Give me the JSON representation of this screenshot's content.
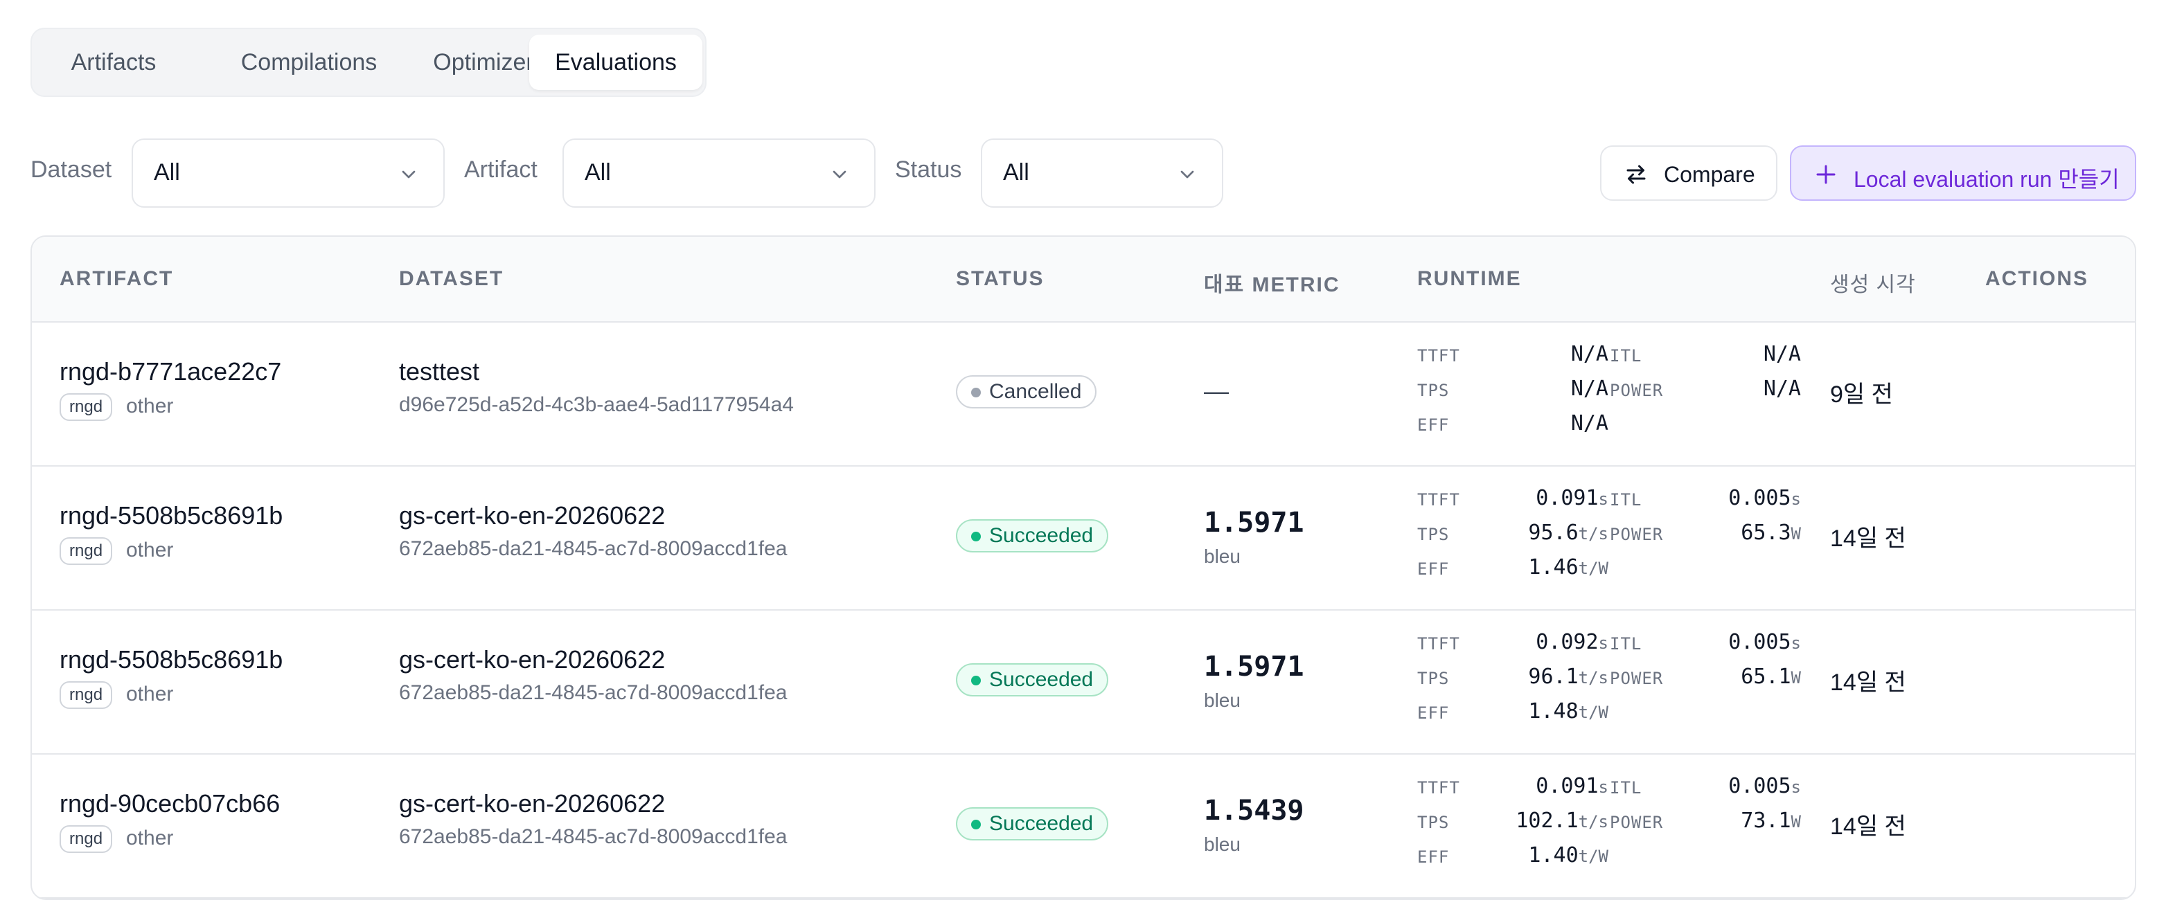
{
  "tabs": [
    {
      "label": "Artifacts",
      "active": false
    },
    {
      "label": "Compilations",
      "active": false
    },
    {
      "label": "Optimizer",
      "active": false
    },
    {
      "label": "Evaluations",
      "active": true
    }
  ],
  "filters": {
    "dataset": {
      "label": "Dataset",
      "value": "All"
    },
    "artifact": {
      "label": "Artifact",
      "value": "All"
    },
    "status": {
      "label": "Status",
      "value": "All"
    }
  },
  "actions": {
    "compare_label": "Compare",
    "compare_icon": "swap-arrows-icon",
    "local_run_label": "Local evaluation run 만들기",
    "local_run_icon": "plus-icon"
  },
  "table": {
    "headers": [
      "ARTIFACT",
      "DATASET",
      "STATUS",
      "대표 METRIC",
      "RUNTIME",
      "생성 시각",
      "ACTIONS"
    ],
    "rows": [
      {
        "artifact": "rngd-b7771ace22c7",
        "tag": "rngd",
        "category": "other",
        "dataset": "testtest",
        "dataset_id": "d96e725d-a52d-4c3b-aae4-5ad1177954a4",
        "status": "Cancelled",
        "metric_value": "—",
        "metric_unit": "",
        "runtime": {
          "ttft": "N/A",
          "ttft_u": "",
          "itl": "N/A",
          "itl_u": "",
          "tps": "N/A",
          "tps_u": "",
          "power": "N/A",
          "power_u": "",
          "eff": "N/A",
          "eff_u": ""
        },
        "created": "9일 전"
      },
      {
        "artifact": "rngd-5508b5c8691b",
        "tag": "rngd",
        "category": "other",
        "dataset": "gs-cert-ko-en-20260622",
        "dataset_id": "672aeb85-da21-4845-ac7d-8009accd1fea",
        "status": "Succeeded",
        "metric_value": "1.5971",
        "metric_unit": "bleu",
        "runtime": {
          "ttft": "0.091",
          "ttft_u": "s",
          "itl": "0.005",
          "itl_u": "s",
          "tps": "95.6",
          "tps_u": "t/s",
          "power": "65.3",
          "power_u": "W",
          "eff": "1.46",
          "eff_u": "t/W"
        },
        "created": "14일 전"
      },
      {
        "artifact": "rngd-5508b5c8691b",
        "tag": "rngd",
        "category": "other",
        "dataset": "gs-cert-ko-en-20260622",
        "dataset_id": "672aeb85-da21-4845-ac7d-8009accd1fea",
        "status": "Succeeded",
        "metric_value": "1.5971",
        "metric_unit": "bleu",
        "runtime": {
          "ttft": "0.092",
          "ttft_u": "s",
          "itl": "0.005",
          "itl_u": "s",
          "tps": "96.1",
          "tps_u": "t/s",
          "power": "65.1",
          "power_u": "W",
          "eff": "1.48",
          "eff_u": "t/W"
        },
        "created": "14일 전"
      },
      {
        "artifact": "rngd-90cecb07cb66",
        "tag": "rngd",
        "category": "other",
        "dataset": "gs-cert-ko-en-20260622",
        "dataset_id": "672aeb85-da21-4845-ac7d-8009accd1fea",
        "status": "Succeeded",
        "metric_value": "1.5439",
        "metric_unit": "bleu",
        "runtime": {
          "ttft": "0.091",
          "ttft_u": "s",
          "itl": "0.005",
          "itl_u": "s",
          "tps": "102.1",
          "tps_u": "t/s",
          "power": "73.1",
          "power_u": "W",
          "eff": "1.40",
          "eff_u": "t/W"
        },
        "created": "14일 전"
      }
    ],
    "runtime_labels": {
      "ttft": "TTFT",
      "itl": "ITL",
      "tps": "TPS",
      "power": "POWER",
      "eff": "EFF"
    }
  },
  "colors": {
    "accent": "#6d28d9",
    "accent_bg": "#ede9fe",
    "success": "#047857",
    "success_bg": "#ecfdf5",
    "neutral_dot": "#9ca3af"
  }
}
